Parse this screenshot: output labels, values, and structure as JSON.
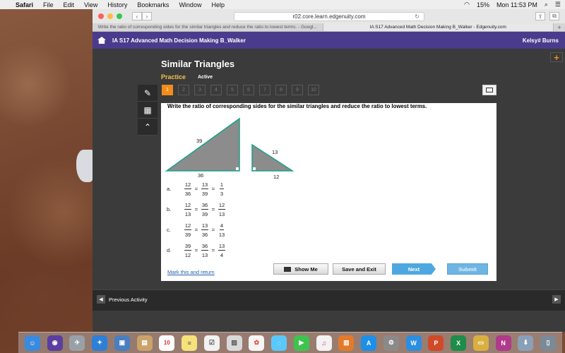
{
  "menubar": {
    "app": "Safari",
    "items": [
      "File",
      "Edit",
      "View",
      "History",
      "Bookmarks",
      "Window",
      "Help"
    ],
    "battery": "15%",
    "clock": "Mon 11:53 PM"
  },
  "browser": {
    "url": "r02.core.learn.edgenuity.com",
    "tabs": [
      {
        "label": "Write the ratio of corresponding sides for the similar triangles and reduce the ratio to lowest terms. - Googl...",
        "active": false
      },
      {
        "label": "IA S17 Advanced Math Decision Making B_Walker - Edgenuity.com",
        "active": true
      }
    ]
  },
  "course": {
    "title": "IA S17 Advanced Math Decision Making B_Walker",
    "user": "Kelsy# Burns"
  },
  "lesson": {
    "title": "Similar Triangles",
    "mode": "Practice",
    "status": "Active",
    "questions": [
      "1",
      "2",
      "3",
      "4",
      "5",
      "6",
      "7",
      "8",
      "9",
      "10"
    ],
    "current_question": "1"
  },
  "question": {
    "prompt": "Write the ratio of corresponding sides for the similar triangles and reduce the ratio to lowest terms.",
    "large_triangle": {
      "hypotenuse": "39",
      "base": "36"
    },
    "small_triangle": {
      "hypotenuse": "13",
      "base": "12"
    },
    "choices": [
      {
        "letter": "a.",
        "fractions": [
          [
            "12",
            "36"
          ],
          [
            "13",
            "39"
          ],
          [
            "1",
            "3"
          ]
        ]
      },
      {
        "letter": "b.",
        "fractions": [
          [
            "12",
            "13"
          ],
          [
            "36",
            "39"
          ],
          [
            "12",
            "13"
          ]
        ]
      },
      {
        "letter": "c.",
        "fractions": [
          [
            "12",
            "39"
          ],
          [
            "13",
            "36"
          ],
          [
            "4",
            "13"
          ]
        ]
      },
      {
        "letter": "d.",
        "fractions": [
          [
            "39",
            "12"
          ],
          [
            "36",
            "13"
          ],
          [
            "13",
            "4"
          ]
        ]
      }
    ],
    "equals": "="
  },
  "footer": {
    "mark_link": "Mark this and return",
    "show_me": "Show Me",
    "save_exit": "Save and Exit",
    "next": "Next",
    "submit": "Submit"
  },
  "bottom": {
    "previous_activity": "Previous Activity"
  },
  "dock": {
    "calendar_day": "10"
  },
  "colors": {
    "course_bar": "#4b3b8d",
    "current_question": "#f28c1b",
    "mode_text": "#f0c04e",
    "next_button": "#4ea8df"
  }
}
